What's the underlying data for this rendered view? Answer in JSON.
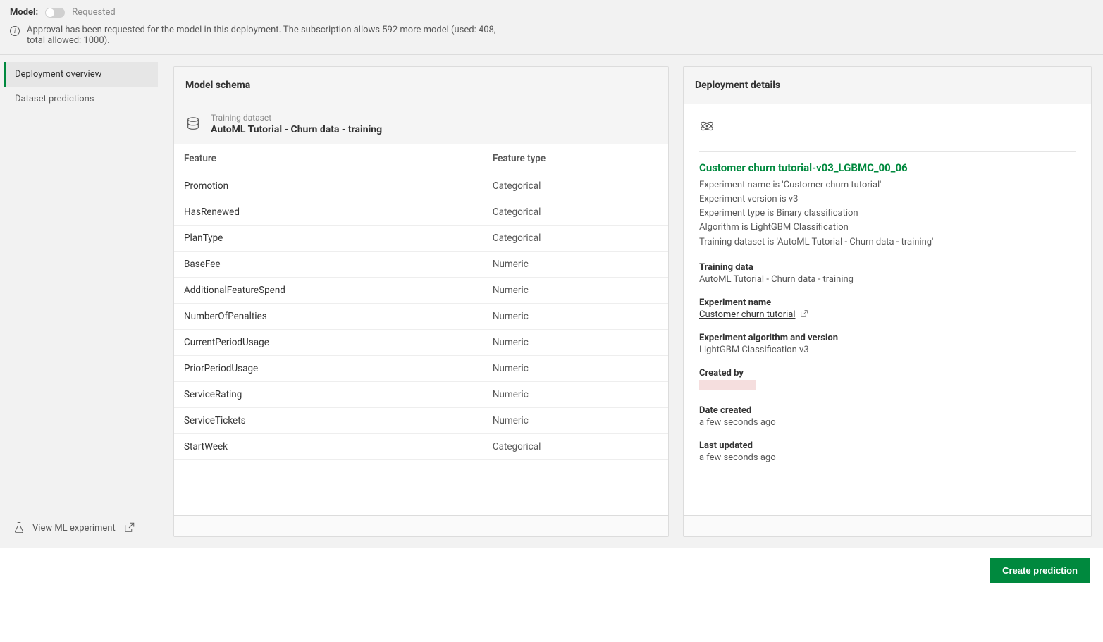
{
  "top": {
    "model_label": "Model:",
    "status": "Requested",
    "notice": "Approval has been requested for the model in this deployment. The subscription allows 592 more model (used: 408, total allowed: 1000)."
  },
  "sidebar": {
    "items": [
      {
        "label": "Deployment overview",
        "selected": true
      },
      {
        "label": "Dataset predictions",
        "selected": false
      }
    ],
    "footer_label": "View ML experiment"
  },
  "schema_panel": {
    "title": "Model schema",
    "dataset_label": "Training dataset",
    "dataset_name": "AutoML Tutorial - Churn data - training",
    "columns": {
      "feature": "Feature",
      "type": "Feature type"
    },
    "rows": [
      {
        "feature": "Promotion",
        "type": "Categorical"
      },
      {
        "feature": "HasRenewed",
        "type": "Categorical"
      },
      {
        "feature": "PlanType",
        "type": "Categorical"
      },
      {
        "feature": "BaseFee",
        "type": "Numeric"
      },
      {
        "feature": "AdditionalFeatureSpend",
        "type": "Numeric"
      },
      {
        "feature": "NumberOfPenalties",
        "type": "Numeric"
      },
      {
        "feature": "CurrentPeriodUsage",
        "type": "Numeric"
      },
      {
        "feature": "PriorPeriodUsage",
        "type": "Numeric"
      },
      {
        "feature": "ServiceRating",
        "type": "Numeric"
      },
      {
        "feature": "ServiceTickets",
        "type": "Numeric"
      },
      {
        "feature": "StartWeek",
        "type": "Categorical"
      }
    ]
  },
  "details_panel": {
    "title": "Deployment details",
    "model_name": "Customer churn tutorial-v03_LGBMC_00_06",
    "lines": [
      "Experiment name is 'Customer churn tutorial'",
      "Experiment version is v3",
      "Experiment type is Binary classification",
      "Algorithm is LightGBM Classification",
      "Training dataset is 'AutoML Tutorial - Churn data - training'"
    ],
    "training_data_label": "Training data",
    "training_data_value": "AutoML Tutorial - Churn data - training",
    "experiment_name_label": "Experiment name",
    "experiment_name_value": "Customer churn tutorial",
    "algo_label": "Experiment algorithm and version",
    "algo_value": "LightGBM Classification v3",
    "created_by_label": "Created by",
    "date_created_label": "Date created",
    "date_created_value": "a few seconds ago",
    "last_updated_label": "Last updated",
    "last_updated_value": "a few seconds ago"
  },
  "actions": {
    "create_prediction": "Create prediction"
  }
}
